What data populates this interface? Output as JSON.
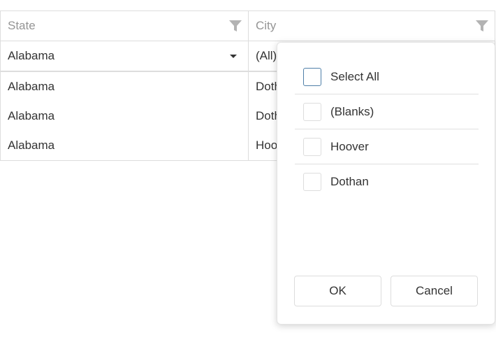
{
  "columns": {
    "state": {
      "header": "State",
      "filter_value": "Alabama"
    },
    "city": {
      "header": "City",
      "filter_value": "(All)"
    }
  },
  "rows": [
    {
      "state": "Alabama",
      "city": "Dothan"
    },
    {
      "state": "Alabama",
      "city": "Dothan"
    },
    {
      "state": "Alabama",
      "city": "Hoover"
    }
  ],
  "filter_popup": {
    "items": [
      {
        "label": "Select All",
        "checked": false
      },
      {
        "label": "(Blanks)",
        "checked": false
      },
      {
        "label": "Hoover",
        "checked": false
      },
      {
        "label": "Dothan",
        "checked": false
      }
    ],
    "ok_label": "OK",
    "cancel_label": "Cancel"
  },
  "icons": {
    "header_filter": "funnel-icon",
    "dropdown": "caret-down-icon"
  },
  "colors": {
    "border": "#dddddd",
    "header_text": "#959595",
    "funnel": "#b3b3b3",
    "select_all_border": "#4f7fa8"
  }
}
